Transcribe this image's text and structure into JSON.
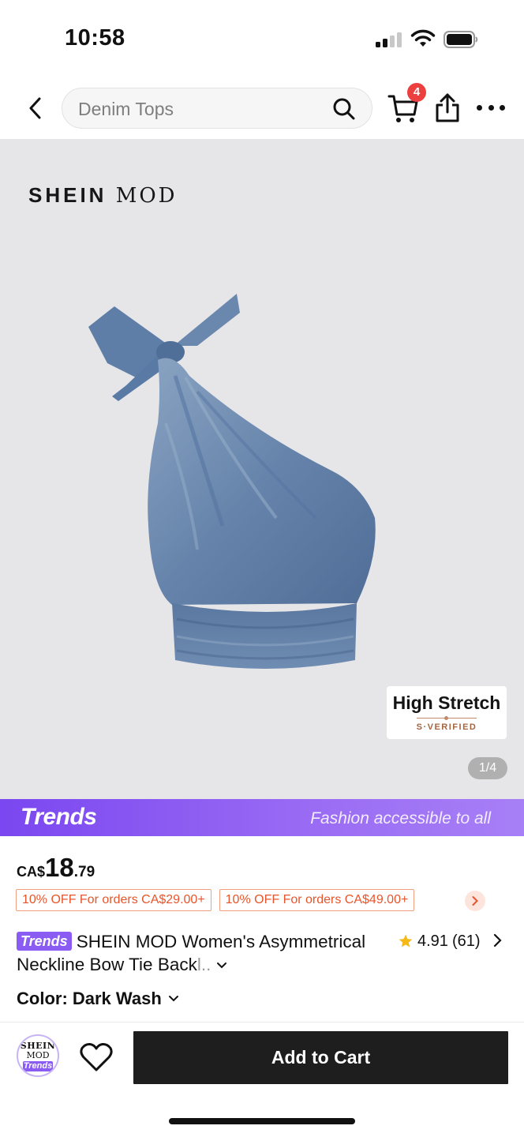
{
  "status_bar": {
    "time": "10:58"
  },
  "nav": {
    "search_placeholder": "Denim Tops",
    "cart_count": "4"
  },
  "product_image": {
    "brand_logo_lead": "SHEIN",
    "brand_logo_tail": "MOD",
    "badge_title": "High Stretch",
    "badge_subtitle": "S·VERIFIED",
    "page_indicator": "1/4"
  },
  "trends_banner": {
    "logo": "Trends",
    "tagline": "Fashion accessible to all"
  },
  "price": {
    "currency": "CA$",
    "integer": "18",
    "decimal": ".79"
  },
  "coupons": [
    "10% OFF For orders CA$29.00+",
    "10% OFF For orders CA$49.00+"
  ],
  "product": {
    "tag": "Trends",
    "title": "SHEIN MOD Women's Asymmetrical Neckline Bow Tie Back",
    "title_fade": "l..",
    "rating": "4.91",
    "review_count": "(61)",
    "color_label": "Color: Dark Wash"
  },
  "action_bar": {
    "store_line1": "SHEIN",
    "store_line2": "MOD",
    "store_line3": "Trends",
    "add_to_cart": "Add to Cart"
  },
  "colors": {
    "accent_purple": "#8b5cf3",
    "coupon_orange": "#e8552c",
    "cart_badge_red": "#ec3f3f",
    "denim": "#5f7fa6"
  }
}
